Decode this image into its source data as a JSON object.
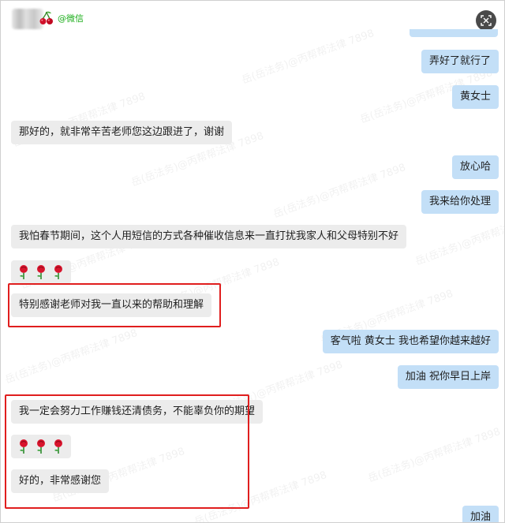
{
  "header": {
    "source_label": "@微信",
    "close_icon": "close-screen-icon"
  },
  "watermark": "岳(岳法务)@丙帮帮法律 7898",
  "messages": {
    "m1": "弄好了就行了",
    "m2": "黄女士",
    "m3": "那好的，就非常辛苦老师您这边跟进了，谢谢",
    "m4": "放心哈",
    "m5": "我来给你处理",
    "m6": "我怕春节期间，这个人用短信的方式各种催收信息来一直打扰我家人和父母特别不好",
    "m7": "特别感谢老师对我一直以来的帮助和理解",
    "m8": "客气啦 黄女士 我也希望你越来越好",
    "m9": "加油 祝你早日上岸",
    "m10": "我一定会努力工作赚钱还清债务，不能辜负你的期望",
    "m11": "好的，非常感谢您",
    "m12": "加油"
  },
  "emoji": {
    "rose": "rose-icon"
  },
  "colors": {
    "outgoing": "#c3dff7",
    "incoming": "#ececec",
    "highlight": "#e01e1e",
    "brand_green": "#1aad19"
  }
}
